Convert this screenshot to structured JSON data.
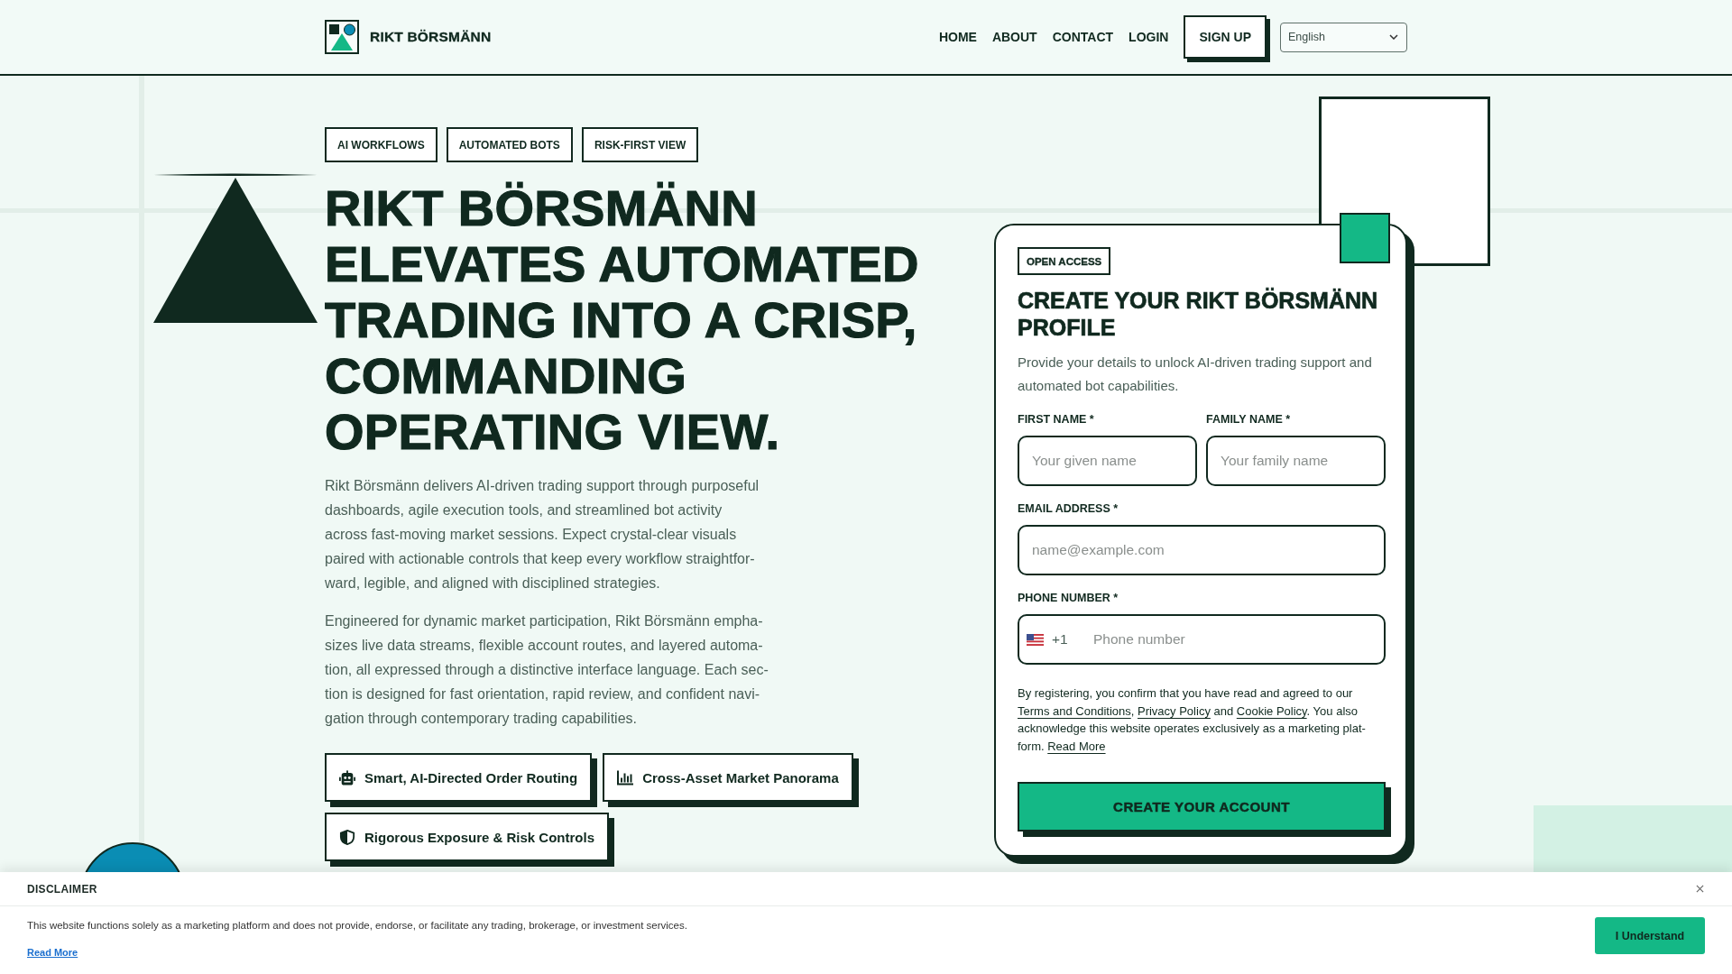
{
  "header": {
    "brand": "RIKT BÖRSMÄNN",
    "nav": [
      "HOME",
      "ABOUT",
      "CONTACT",
      "LOGIN"
    ],
    "signup_button": "SIGN UP",
    "language": "English"
  },
  "hero": {
    "tags": [
      "AI WORKFLOWS",
      "AUTOMATED BOTS",
      "RISK-FIRST VIEW"
    ],
    "heading": "RIKT BÖRSMÄNN ELEVATES AUTOMATED TRADING INTO A CRISP, COMMANDING OPERATING VIEW.",
    "paragraphs": [
      "Rikt Börsmänn delivers AI-driven trading support through purposeful\ndashboards, agile execution tools, and streamlined bot activity\nacross fast-moving market sessions. Expect crystal-clear visuals\npaired with actionable controls that keep every workflow straightfor-\nward, legible, and aligned with disciplined strategies.",
      "Engineered for dynamic market participation, Rikt Börsmänn empha-\nsizes live data streams, flexible account routes, and layered automa-\ntion, all expressed through a distinctive interface language. Each sec-\ntion is designed for fast orientation, rapid review, and confident navi-\ngation through contemporary trading capabilities."
    ],
    "features": [
      "Smart, AI-Directed Order Routing",
      "Cross-Asset Market Panorama",
      "Rigorous Exposure & Risk Controls"
    ]
  },
  "signup_card": {
    "badge": "OPEN ACCESS",
    "title": "CREATE YOUR RIKT BÖRSMÄNN PROFILE",
    "description": "Provide your details to unlock AI-driven trading support and automated bot capabilities.",
    "field_rows": [
      [
        {
          "kind": "text",
          "label": "FIRST NAME *",
          "placeholder": "Your given name"
        },
        {
          "kind": "text",
          "label": "FAMILY NAME *",
          "placeholder": "Your family name"
        }
      ],
      [
        {
          "kind": "email",
          "label": "EMAIL ADDRESS *",
          "placeholder": "name@example.com"
        }
      ],
      [
        {
          "kind": "phone",
          "label": "PHONE NUMBER *",
          "dial_code": "+1",
          "placeholder": "Phone number"
        }
      ]
    ],
    "consent": [
      {
        "kind": "text",
        "text": "By registering, you confirm that you have read and agreed to our\n"
      },
      {
        "kind": "link",
        "text": "Terms and Conditions"
      },
      {
        "kind": "text",
        "text": ", "
      },
      {
        "kind": "link",
        "text": "Privacy Policy"
      },
      {
        "kind": "text",
        "text": " and "
      },
      {
        "kind": "link",
        "text": "Cookie Policy"
      },
      {
        "kind": "text",
        "text": ". You also\nacknowledge this website operates exclusively as a marketing plat-\nform. "
      },
      {
        "kind": "link",
        "text": "Read More"
      }
    ],
    "submit_button": "CREATE YOUR ACCOUNT"
  },
  "disclaimer": {
    "title": "DISCLAIMER",
    "text": "This website functions solely as a marketing platform and does not provide, endorse, or facilitate any trading, brokerage, or investment services.",
    "link": "Read More",
    "button": "I Understand"
  }
}
